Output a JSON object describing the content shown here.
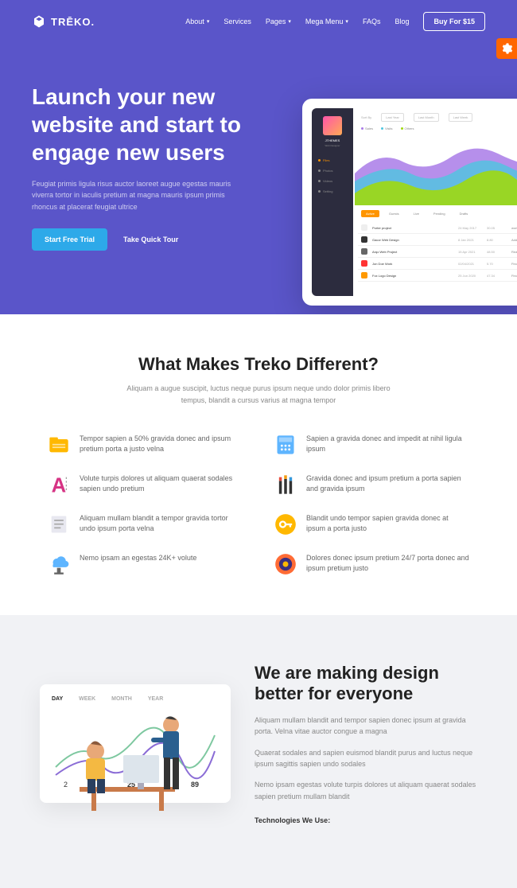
{
  "brand": "TRĒKO.",
  "nav": {
    "items": [
      {
        "label": "About",
        "caret": true
      },
      {
        "label": "Services",
        "caret": false
      },
      {
        "label": "Pages",
        "caret": true
      },
      {
        "label": "Mega Menu",
        "caret": true
      },
      {
        "label": "FAQs",
        "caret": false
      },
      {
        "label": "Blog",
        "caret": false
      }
    ],
    "buy": "Buy For $15"
  },
  "hero": {
    "title": "Launch your new website and start to engage new users",
    "desc": "Feugiat primis ligula risus auctor laoreet augue egestas mauris viverra tortor in iaculis pretium at magna mauris ipsum primis rhoncus at placerat feugiat ultrice",
    "cta_primary": "Start Free Trial",
    "cta_secondary": "Take Quick Tour"
  },
  "tablet": {
    "user": "JTHEMES",
    "role": "Web Designer",
    "menu": [
      "Files",
      "Photos",
      "Videos",
      "Setting"
    ],
    "top_label": "Sort By",
    "top_opts": [
      "Last Year",
      "Last Month",
      "Last Week"
    ],
    "legend": [
      {
        "label": "Sales",
        "color": "#a97be8"
      },
      {
        "label": "Visits",
        "color": "#4ec6e0"
      },
      {
        "label": "Others",
        "color": "#a0d911"
      }
    ],
    "tabs": [
      "Active",
      "Guests",
      "Live",
      "Pending",
      "Drafts"
    ],
    "rows": [
      {
        "name": "Porter project",
        "date": "24 May 2017",
        "progress": "30.05",
        "status": "work by",
        "color": "#fff"
      },
      {
        "name": "Gacor Web Design",
        "date": "8 Jan 2021",
        "progress": "8.80",
        "status": "Add in",
        "color": "#333"
      },
      {
        "name": "Arqo Web Project",
        "date": "15 Apr 2021",
        "progress": "48.50",
        "status": "React",
        "color": "#666"
      },
      {
        "name": "Jon Doe Work",
        "date": "02/04/2021",
        "progress": "5.70",
        "status": "Finder",
        "color": "#f33"
      },
      {
        "name": "Fox Logo Design",
        "date": "25 Jun 2020",
        "progress": "47.34",
        "status": "Finder",
        "color": "#f90"
      }
    ]
  },
  "features": {
    "title": "What Makes Treko Different?",
    "sub": "Aliquam a augue suscipit, luctus neque purus ipsum neque undo dolor primis libero tempus, blandit a cursus varius at magna tempor",
    "items": [
      {
        "text": "Tempor sapien a 50% gravida donec and ipsum pretium porta a justo velna"
      },
      {
        "text": "Sapien a gravida donec and impedit at nihil ligula ipsum"
      },
      {
        "text": "Volute turpis dolores ut aliquam quaerat sodales sapien undo pretium"
      },
      {
        "text": "Gravida donec and ipsum pretium a porta sapien and gravida ipsum"
      },
      {
        "text": "Aliquam mullam blandit a tempor gravida tortor undo ipsum porta velna"
      },
      {
        "text": "Blandit undo tempor sapien gravida donec at ipsum a porta justo"
      },
      {
        "text": "Nemo ipsam an egestas 24K+ volute"
      },
      {
        "text": "Dolores donec ipsum pretium 24/7 porta donec and ipsum pretium justo"
      }
    ]
  },
  "about": {
    "tabs": [
      "DAY",
      "WEEK",
      "MONTH",
      "YEAR"
    ],
    "title": "We are making design better for everyone",
    "p1": "Aliquam mullam blandit and tempor sapien donec ipsum at gravida porta. Velna vitae auctor congue a magna",
    "p2": "Quaerat sodales and sapien euismod blandit purus and luctus neque ipsum sagittis sapien undo sodales",
    "p3": "Nemo ipsam egestas volute turpis dolores ut aliquam quaerat sodales sapien pretium mullam blandit",
    "tech": "Technologies We Use:"
  },
  "chart_stats": [
    "2",
    "25",
    "89"
  ]
}
